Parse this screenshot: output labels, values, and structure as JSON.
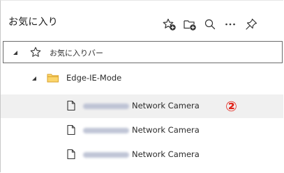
{
  "panel": {
    "title": "お気に入り"
  },
  "toolbar": {
    "icons": [
      "add-favorite-icon",
      "add-folder-icon",
      "search-icon",
      "more-icon",
      "pin-icon"
    ]
  },
  "favorites_bar": {
    "label": "お気に入りバー"
  },
  "folder": {
    "label": "Edge-IE-Mode"
  },
  "items": [
    {
      "label": "Network Camera",
      "marker": "②"
    },
    {
      "label": "Network Camera"
    },
    {
      "label": "Network Camera"
    }
  ],
  "colors": {
    "marker": "#e2231a",
    "folder": "#f4c542",
    "selected_row": "#f0f0f0"
  }
}
